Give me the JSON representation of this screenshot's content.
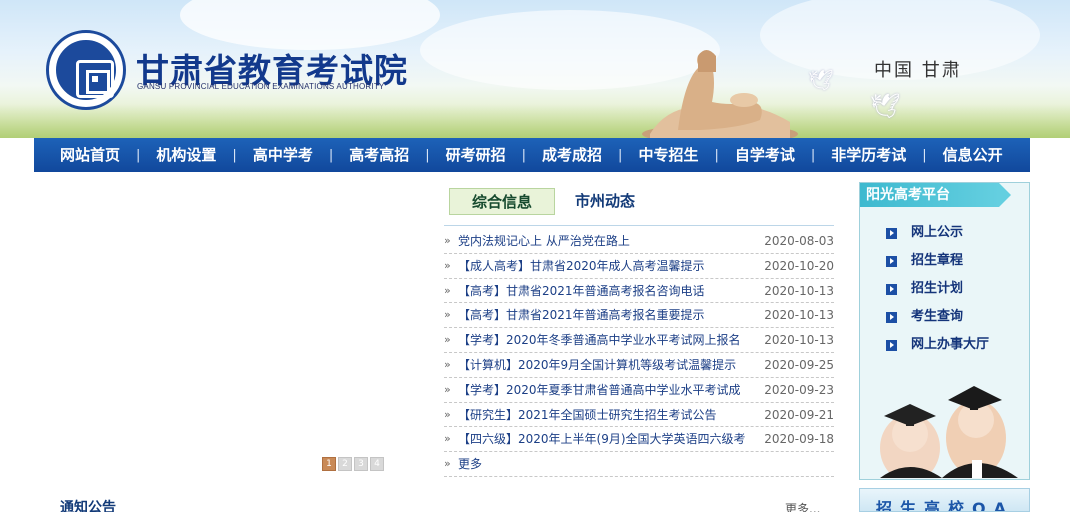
{
  "header": {
    "title": "甘肃省教育考试院",
    "subtitle": "GANSU PROVINCIAL EDUCATION EXAMINATIONS AUTHORITY",
    "region": "中国 甘肃",
    "emblem_icon": "emblem-seal",
    "colors": {
      "brand": "#12398c",
      "nav": "#11489c"
    }
  },
  "nav": {
    "items": [
      "网站首页",
      "机构设置",
      "高中学考",
      "高考高招",
      "研考研招",
      "成考成招",
      "中专招生",
      "自学考试",
      "非学历考试",
      "信息公开"
    ]
  },
  "news": {
    "tabs": [
      {
        "label": "综合信息",
        "active": true
      },
      {
        "label": "市州动态",
        "active": false
      }
    ],
    "items": [
      {
        "title": "党内法规记心上 从严治党在路上",
        "date": "2020-08-03"
      },
      {
        "title": "【成人高考】甘肃省2020年成人高考温馨提示",
        "date": "2020-10-20"
      },
      {
        "title": "【高考】甘肃省2021年普通高考报名咨询电话",
        "date": "2020-10-13"
      },
      {
        "title": "【高考】甘肃省2021年普通高考报名重要提示",
        "date": "2020-10-13"
      },
      {
        "title": "【学考】2020年冬季普通高中学业水平考试网上报名",
        "date": "2020-10-13"
      },
      {
        "title": "【计算机】2020年9月全国计算机等级考试温馨提示",
        "date": "2020-09-25"
      },
      {
        "title": "【学考】2020年夏季甘肃省普通高中学业水平考试成",
        "date": "2020-09-23"
      },
      {
        "title": "【研究生】2021年全国硕士研究生招生考试公告",
        "date": "2020-09-21"
      },
      {
        "title": "【四六级】2020年上半年(9月)全国大学英语四六级考",
        "date": "2020-09-18"
      }
    ],
    "more_label": "更多"
  },
  "carousel": {
    "dots": [
      "1",
      "2",
      "3",
      "4"
    ],
    "active_index": 0
  },
  "sidebar": {
    "title": "阳光高考平台",
    "items": [
      "网上公示",
      "招生章程",
      "招生计划",
      "考生查询",
      "网上办事大厅"
    ]
  },
  "bottom": {
    "notice_title": "通知公告",
    "more_label": "更多...",
    "qa_banner": "招生高校QA"
  }
}
